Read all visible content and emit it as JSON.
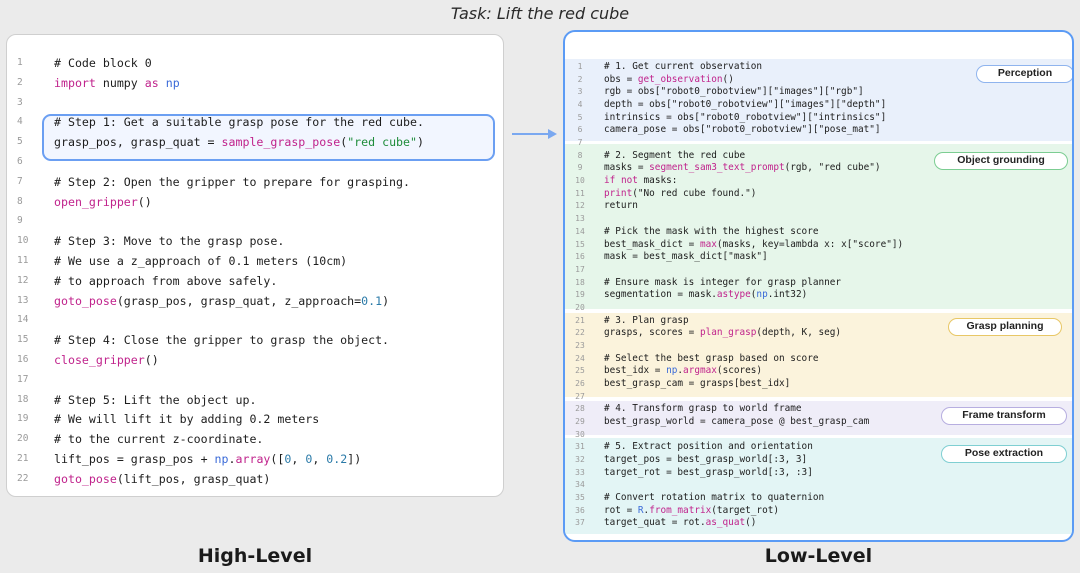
{
  "task_title": "Task: Lift the red cube",
  "high_level": {
    "label": "High-Level",
    "lines": [
      {
        "n": "1",
        "t": [
          {
            "s": "# Code block 0",
            "c": ""
          }
        ]
      },
      {
        "n": "2",
        "t": [
          {
            "s": "import",
            "c": "kw"
          },
          {
            "s": " numpy ",
            "c": ""
          },
          {
            "s": "as",
            "c": "kw"
          },
          {
            "s": " np",
            "c": "np"
          }
        ]
      },
      {
        "n": "3",
        "t": []
      },
      {
        "n": "4",
        "t": [
          {
            "s": "# Step 1: Get a suitable grasp pose for the red cube.",
            "c": ""
          }
        ]
      },
      {
        "n": "5",
        "t": [
          {
            "s": "grasp_pos, grasp_quat = ",
            "c": ""
          },
          {
            "s": "sample_grasp_pose",
            "c": "fn"
          },
          {
            "s": "(",
            "c": ""
          },
          {
            "s": "\"red cube\"",
            "c": "str"
          },
          {
            "s": ")",
            "c": ""
          }
        ]
      },
      {
        "n": "6",
        "t": []
      },
      {
        "n": "7",
        "t": [
          {
            "s": "# Step 2: Open the gripper to prepare for grasping.",
            "c": ""
          }
        ]
      },
      {
        "n": "8",
        "t": [
          {
            "s": "open_gripper",
            "c": "fn"
          },
          {
            "s": "()",
            "c": ""
          }
        ]
      },
      {
        "n": "9",
        "t": []
      },
      {
        "n": "10",
        "t": [
          {
            "s": "# Step 3: Move to the grasp pose.",
            "c": ""
          }
        ]
      },
      {
        "n": "11",
        "t": [
          {
            "s": "# We use a z_approach of 0.1 meters (10cm)",
            "c": ""
          }
        ]
      },
      {
        "n": "12",
        "t": [
          {
            "s": "# to approach from above safely.",
            "c": ""
          }
        ]
      },
      {
        "n": "13",
        "t": [
          {
            "s": "goto_pose",
            "c": "fn"
          },
          {
            "s": "(grasp_pos, grasp_quat, z_approach=",
            "c": ""
          },
          {
            "s": "0.1",
            "c": "num"
          },
          {
            "s": ")",
            "c": ""
          }
        ]
      },
      {
        "n": "14",
        "t": []
      },
      {
        "n": "15",
        "t": [
          {
            "s": "# Step 4: Close the gripper to grasp the object.",
            "c": ""
          }
        ]
      },
      {
        "n": "16",
        "t": [
          {
            "s": "close_gripper",
            "c": "fn"
          },
          {
            "s": "()",
            "c": ""
          }
        ]
      },
      {
        "n": "17",
        "t": []
      },
      {
        "n": "18",
        "t": [
          {
            "s": "# Step 5: Lift the object up.",
            "c": ""
          }
        ]
      },
      {
        "n": "19",
        "t": [
          {
            "s": "# We will lift it by adding 0.2 meters",
            "c": ""
          }
        ]
      },
      {
        "n": "20",
        "t": [
          {
            "s": "# to the current z-coordinate.",
            "c": ""
          }
        ]
      },
      {
        "n": "21",
        "t": [
          {
            "s": "lift_pos = grasp_pos + ",
            "c": ""
          },
          {
            "s": "np",
            "c": "np"
          },
          {
            "s": ".",
            "c": ""
          },
          {
            "s": "array",
            "c": "fn"
          },
          {
            "s": "([",
            "c": ""
          },
          {
            "s": "0",
            "c": "num"
          },
          {
            "s": ", ",
            "c": ""
          },
          {
            "s": "0",
            "c": "num"
          },
          {
            "s": ", ",
            "c": ""
          },
          {
            "s": "0.2",
            "c": "num"
          },
          {
            "s": "])",
            "c": ""
          }
        ]
      },
      {
        "n": "22",
        "t": [
          {
            "s": "goto_pose",
            "c": "fn"
          },
          {
            "s": "(lift_pos, grasp_quat)",
            "c": ""
          }
        ]
      }
    ]
  },
  "low_level": {
    "label": "Low-Level",
    "tags": {
      "perception": "Perception",
      "grounding": "Object grounding",
      "grasp": "Grasp planning",
      "frame": "Frame transform",
      "pose": "Pose extraction"
    },
    "lines": [
      {
        "n": "1",
        "t": [
          {
            "s": "# 1. Get current observation",
            "c": ""
          }
        ]
      },
      {
        "n": "2",
        "t": [
          {
            "s": "obs = ",
            "c": ""
          },
          {
            "s": "get_observation",
            "c": "fn"
          },
          {
            "s": "()",
            "c": ""
          }
        ]
      },
      {
        "n": "3",
        "t": [
          {
            "s": "rgb = obs[\"robot0_robotview\"][\"images\"][\"rgb\"]",
            "c": ""
          }
        ]
      },
      {
        "n": "4",
        "t": [
          {
            "s": "depth = obs[\"robot0_robotview\"][\"images\"][\"depth\"]",
            "c": ""
          }
        ]
      },
      {
        "n": "5",
        "t": [
          {
            "s": "intrinsics = obs[\"robot0_robotview\"][\"intrinsics\"]",
            "c": ""
          }
        ]
      },
      {
        "n": "6",
        "t": [
          {
            "s": "camera_pose = obs[\"robot0_robotview\"][\"pose_mat\"]",
            "c": ""
          }
        ]
      },
      {
        "n": "7",
        "t": []
      },
      {
        "n": "8",
        "t": [
          {
            "s": "# 2. Segment the red cube",
            "c": ""
          }
        ]
      },
      {
        "n": "9",
        "t": [
          {
            "s": "masks = ",
            "c": ""
          },
          {
            "s": "segment_sam3_text_prompt",
            "c": "fn"
          },
          {
            "s": "(rgb, \"red cube\")",
            "c": ""
          }
        ]
      },
      {
        "n": "10",
        "t": [
          {
            "s": "if",
            "c": "kw"
          },
          {
            "s": " ",
            "c": ""
          },
          {
            "s": "not",
            "c": "kw"
          },
          {
            "s": " masks:",
            "c": ""
          }
        ]
      },
      {
        "n": "11",
        "t": [
          {
            "s": "print",
            "c": "fn"
          },
          {
            "s": "(\"No red cube found.\")",
            "c": ""
          }
        ]
      },
      {
        "n": "12",
        "t": [
          {
            "s": "return",
            "c": ""
          }
        ]
      },
      {
        "n": "13",
        "t": []
      },
      {
        "n": "14",
        "t": [
          {
            "s": "# Pick the mask with the highest score",
            "c": ""
          }
        ]
      },
      {
        "n": "15",
        "t": [
          {
            "s": "best_mask_dict = ",
            "c": ""
          },
          {
            "s": "max",
            "c": "fn"
          },
          {
            "s": "(masks, key=lambda x: x[\"score\"])",
            "c": ""
          }
        ]
      },
      {
        "n": "16",
        "t": [
          {
            "s": "mask = best_mask_dict[\"mask\"]",
            "c": ""
          }
        ]
      },
      {
        "n": "17",
        "t": []
      },
      {
        "n": "18",
        "t": [
          {
            "s": "# Ensure mask is integer for grasp planner",
            "c": ""
          }
        ]
      },
      {
        "n": "19",
        "t": [
          {
            "s": "segmentation = mask.",
            "c": ""
          },
          {
            "s": "astype",
            "c": "fn"
          },
          {
            "s": "(",
            "c": ""
          },
          {
            "s": "np",
            "c": "np"
          },
          {
            "s": ".int32)",
            "c": ""
          }
        ]
      },
      {
        "n": "20",
        "t": []
      },
      {
        "n": "21",
        "t": [
          {
            "s": "# 3. Plan grasp",
            "c": ""
          }
        ]
      },
      {
        "n": "22",
        "t": [
          {
            "s": "grasps, scores = ",
            "c": ""
          },
          {
            "s": "plan_grasp",
            "c": "fn"
          },
          {
            "s": "(depth, K, seg)",
            "c": ""
          }
        ]
      },
      {
        "n": "23",
        "t": []
      },
      {
        "n": "24",
        "t": [
          {
            "s": "# Select the best grasp based on score",
            "c": ""
          }
        ]
      },
      {
        "n": "25",
        "t": [
          {
            "s": "best_idx = ",
            "c": ""
          },
          {
            "s": "np",
            "c": "np"
          },
          {
            "s": ".",
            "c": ""
          },
          {
            "s": "argmax",
            "c": "fn"
          },
          {
            "s": "(scores)",
            "c": ""
          }
        ]
      },
      {
        "n": "26",
        "t": [
          {
            "s": "best_grasp_cam = grasps[best_idx]",
            "c": ""
          }
        ]
      },
      {
        "n": "27",
        "t": []
      },
      {
        "n": "28",
        "t": [
          {
            "s": "# 4. Transform grasp to world frame",
            "c": ""
          }
        ]
      },
      {
        "n": "29",
        "t": [
          {
            "s": "best_grasp_world = camera_pose @ best_grasp_cam",
            "c": ""
          }
        ]
      },
      {
        "n": "30",
        "t": []
      },
      {
        "n": "31",
        "t": [
          {
            "s": "# 5. Extract position and orientation",
            "c": ""
          }
        ]
      },
      {
        "n": "32",
        "t": [
          {
            "s": "target_pos = best_grasp_world[:3, 3]",
            "c": ""
          }
        ]
      },
      {
        "n": "33",
        "t": [
          {
            "s": "target_rot = best_grasp_world[:3, :3]",
            "c": ""
          }
        ]
      },
      {
        "n": "34",
        "t": []
      },
      {
        "n": "35",
        "t": [
          {
            "s": "# Convert rotation matrix to quaternion",
            "c": ""
          }
        ]
      },
      {
        "n": "36",
        "t": [
          {
            "s": "rot = ",
            "c": ""
          },
          {
            "s": "R",
            "c": "np"
          },
          {
            "s": ".",
            "c": ""
          },
          {
            "s": "from_matrix",
            "c": "fn"
          },
          {
            "s": "(target_rot)",
            "c": ""
          }
        ]
      },
      {
        "n": "37",
        "t": [
          {
            "s": "target_quat = rot.",
            "c": ""
          },
          {
            "s": "as_quat",
            "c": "fn"
          },
          {
            "s": "()",
            "c": ""
          }
        ]
      }
    ]
  },
  "colors": {
    "highlight_border": "#6b9ff2",
    "right_panel_border": "#5b9bf5",
    "arrow": "#7aa8f0",
    "perception": "#e9f0fb",
    "grounding": "#e6f6ea",
    "grasp": "#fbf3dc",
    "frame": "#efedf8",
    "pose": "#e3f5f5"
  }
}
